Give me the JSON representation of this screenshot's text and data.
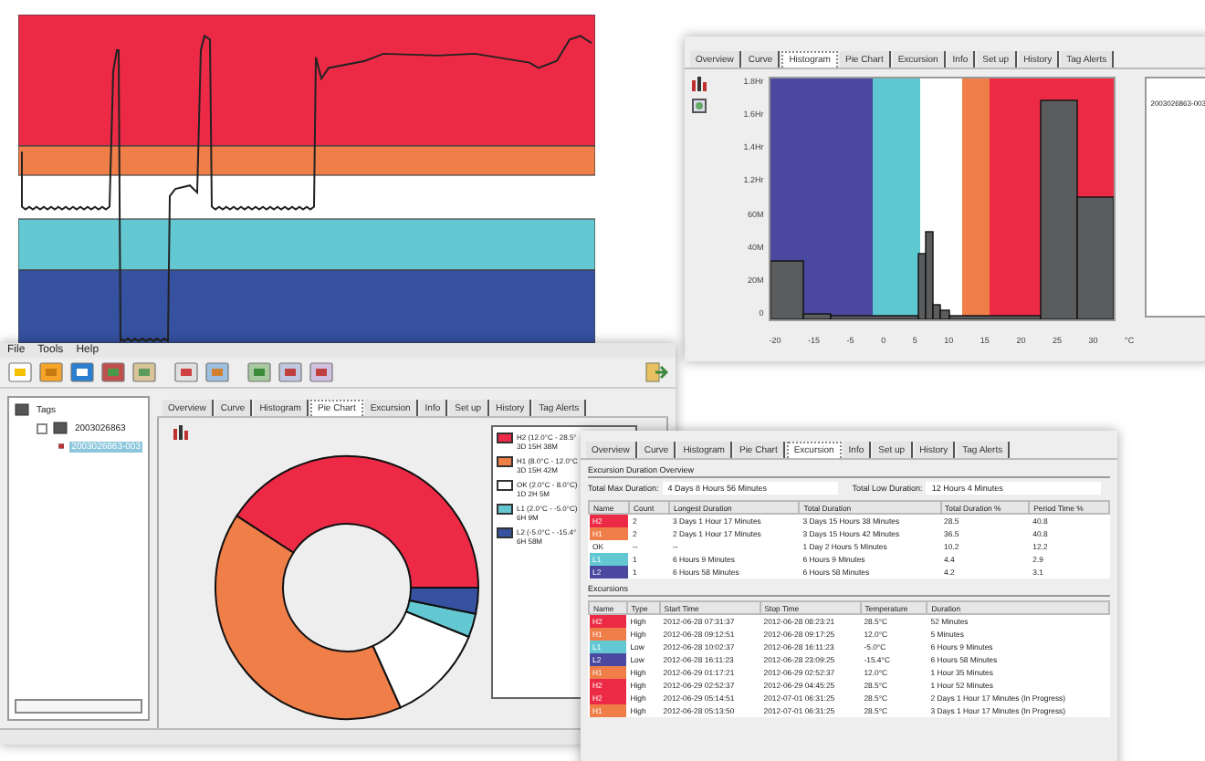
{
  "histogram_window": {
    "tabs": [
      {
        "label": "Overview",
        "selected": false
      },
      {
        "label": "Curve",
        "selected": false
      },
      {
        "label": "Histogram",
        "selected": true
      },
      {
        "label": "Pie Chart",
        "selected": false
      },
      {
        "label": "Excursion",
        "selected": false
      },
      {
        "label": "Info",
        "selected": false
      },
      {
        "label": "Set up",
        "selected": false
      },
      {
        "label": "History",
        "selected": false
      },
      {
        "label": "Tag Alerts",
        "selected": false
      }
    ],
    "y_ticks": [
      "1.8Hr",
      "1.6Hr",
      "1.4Hr",
      "1.2Hr",
      "60M",
      "40M",
      "20M",
      "0"
    ],
    "x_ticks": [
      "-20",
      "-15",
      "-5",
      "0",
      "5",
      "10",
      "15",
      "20",
      "25",
      "30"
    ],
    "unit": "°C",
    "legend_text": "2003026863-003"
  },
  "main_window": {
    "menu": [
      "File",
      "Tools",
      "Help"
    ],
    "tree": [
      {
        "label": "Tags",
        "children": [
          {
            "label": "2003026863",
            "children": [
              {
                "label": "2003026863-003",
                "selected": true
              }
            ]
          }
        ]
      }
    ],
    "tabs": [
      {
        "label": "Overview",
        "selected": false
      },
      {
        "label": "Curve",
        "selected": false
      },
      {
        "label": "Histogram",
        "selected": false
      },
      {
        "label": "Pie Chart",
        "selected": true
      },
      {
        "label": "Excursion",
        "selected": false
      },
      {
        "label": "Info",
        "selected": false
      },
      {
        "label": "Set up",
        "selected": false
      },
      {
        "label": "History",
        "selected": false
      },
      {
        "label": "Tag Alerts",
        "selected": false
      }
    ],
    "pie": {
      "chart_data": {
        "type": "donut",
        "series": [
          {
            "values": [
              40.8,
              40.9,
              12.2,
              2.9,
              3.2
            ]
          }
        ]
      }
    },
    "legend": [
      {
        "color": "#ed2a46",
        "label": "H2 (12.0°C - 28.5°",
        "duration": "3D 15H 38M"
      },
      {
        "color": "#f07e48",
        "label": "H1 (8.0°C - 12.0°C",
        "duration": "3D 15H 42M"
      },
      {
        "color": "#ffffff",
        "label": "OK (2.0°C - 8.0°C)",
        "duration": "1D 2H 5M"
      },
      {
        "color": "#64c8d2",
        "label": "L1 (2.0°C - -5.0°C)",
        "duration": "6H 9M"
      },
      {
        "color": "#3551a0",
        "label": "L2 (-5.0°C - -15.4°",
        "duration": "6H 58M"
      }
    ]
  },
  "excursion_window": {
    "tabs": [
      {
        "label": "Overview",
        "selected": false
      },
      {
        "label": "Curve",
        "selected": false
      },
      {
        "label": "Histogram",
        "selected": false
      },
      {
        "label": "Pie Chart",
        "selected": false
      },
      {
        "label": "Excursion",
        "selected": true
      },
      {
        "label": "Info",
        "selected": false
      },
      {
        "label": "Set up",
        "selected": false
      },
      {
        "label": "History",
        "selected": false
      },
      {
        "label": "Tag Alerts",
        "selected": false
      }
    ],
    "overview_title": "Excursion Duration Overview",
    "fields": [
      {
        "label": "Total Max Duration:",
        "value": "4 Days 8 Hours 56 Minutes"
      },
      {
        "label": "Total Low Duration:",
        "value": "12 Hours 4 Minutes"
      }
    ],
    "summary": {
      "columns": [
        "Name",
        "Count",
        "Longest Duration",
        "Total Duration",
        "Total Duration %",
        "Period Time %"
      ],
      "rows": [
        {
          "color": "#ed2a46",
          "cells": [
            "H2",
            "2",
            "3 Days 1 Hour 17 Minutes",
            "3 Days 15 Hours 38 Minutes",
            "28.5",
            "40.8"
          ]
        },
        {
          "color": "#f07e48",
          "cells": [
            "H1",
            "2",
            "2 Days 1 Hour 17 Minutes",
            "3 Days 15 Hours 42 Minutes",
            "36.5",
            "40.8"
          ]
        },
        {
          "color": "#ffffff",
          "cells": [
            "OK",
            "--",
            "--",
            "1 Day 2 Hours 5 Minutes",
            "10.2",
            "12.2"
          ]
        },
        {
          "color": "#64c8d2",
          "cells": [
            "L1",
            "1",
            "6 Hours 9 Minutes",
            "6 Hours 9 Minutes",
            "4.4",
            "2.9"
          ]
        },
        {
          "color": "#4b48a0",
          "cells": [
            "L2",
            "1",
            "6 Hours 58 Minutes",
            "6 Hours 58 Minutes",
            "4.2",
            "3.1"
          ]
        }
      ]
    },
    "excursions_title": "Excursions",
    "excursions": {
      "columns": [
        "Name",
        "Type",
        "Start Time",
        "Stop Time",
        "Temperature",
        "Duration"
      ],
      "rows": [
        {
          "color": "#ed2a46",
          "cells": [
            "H2",
            "High",
            "2012-06-28 07:31:37",
            "2012-06-28 08:23:21",
            "28.5°C",
            "52 Minutes"
          ]
        },
        {
          "color": "#f07e48",
          "cells": [
            "H1",
            "High",
            "2012-06-28 09:12:51",
            "2012-06-28 09:17:25",
            "12.0°C",
            "5 Minutes"
          ]
        },
        {
          "color": "#64c8d2",
          "cells": [
            "L1",
            "Low",
            "2012-06-28 10:02:37",
            "2012-06-28 16:11:23",
            "-5.0°C",
            "6 Hours 9 Minutes"
          ]
        },
        {
          "color": "#4b48a0",
          "cells": [
            "L2",
            "Low",
            "2012-06-28 16:11:23",
            "2012-06-28 23:09:25",
            "-15.4°C",
            "6 Hours 58 Minutes"
          ]
        },
        {
          "color": "#f07e48",
          "cells": [
            "H1",
            "High",
            "2012-06-29 01:17:21",
            "2012-06-29 02:52:37",
            "12.0°C",
            "1 Hour 35 Minutes"
          ]
        },
        {
          "color": "#ed2a46",
          "cells": [
            "H2",
            "High",
            "2012-06-29 02:52:37",
            "2012-06-29 04:45:25",
            "28.5°C",
            "1 Hour 52 Minutes"
          ]
        },
        {
          "color": "#ed2a46",
          "cells": [
            "H2",
            "High",
            "2012-06-29 05:14:51",
            "2012-07-01 06:31:25",
            "28.5°C",
            "2 Days 1 Hour 17 Minutes (In Progress)"
          ]
        },
        {
          "color": "#f07e48",
          "cells": [
            "H1",
            "High",
            "2012-06-28 05:13:50",
            "2012-07-01 06:31:25",
            "28.5°C",
            "3 Days 1 Hour 17 Minutes (In Progress)"
          ]
        }
      ]
    }
  }
}
